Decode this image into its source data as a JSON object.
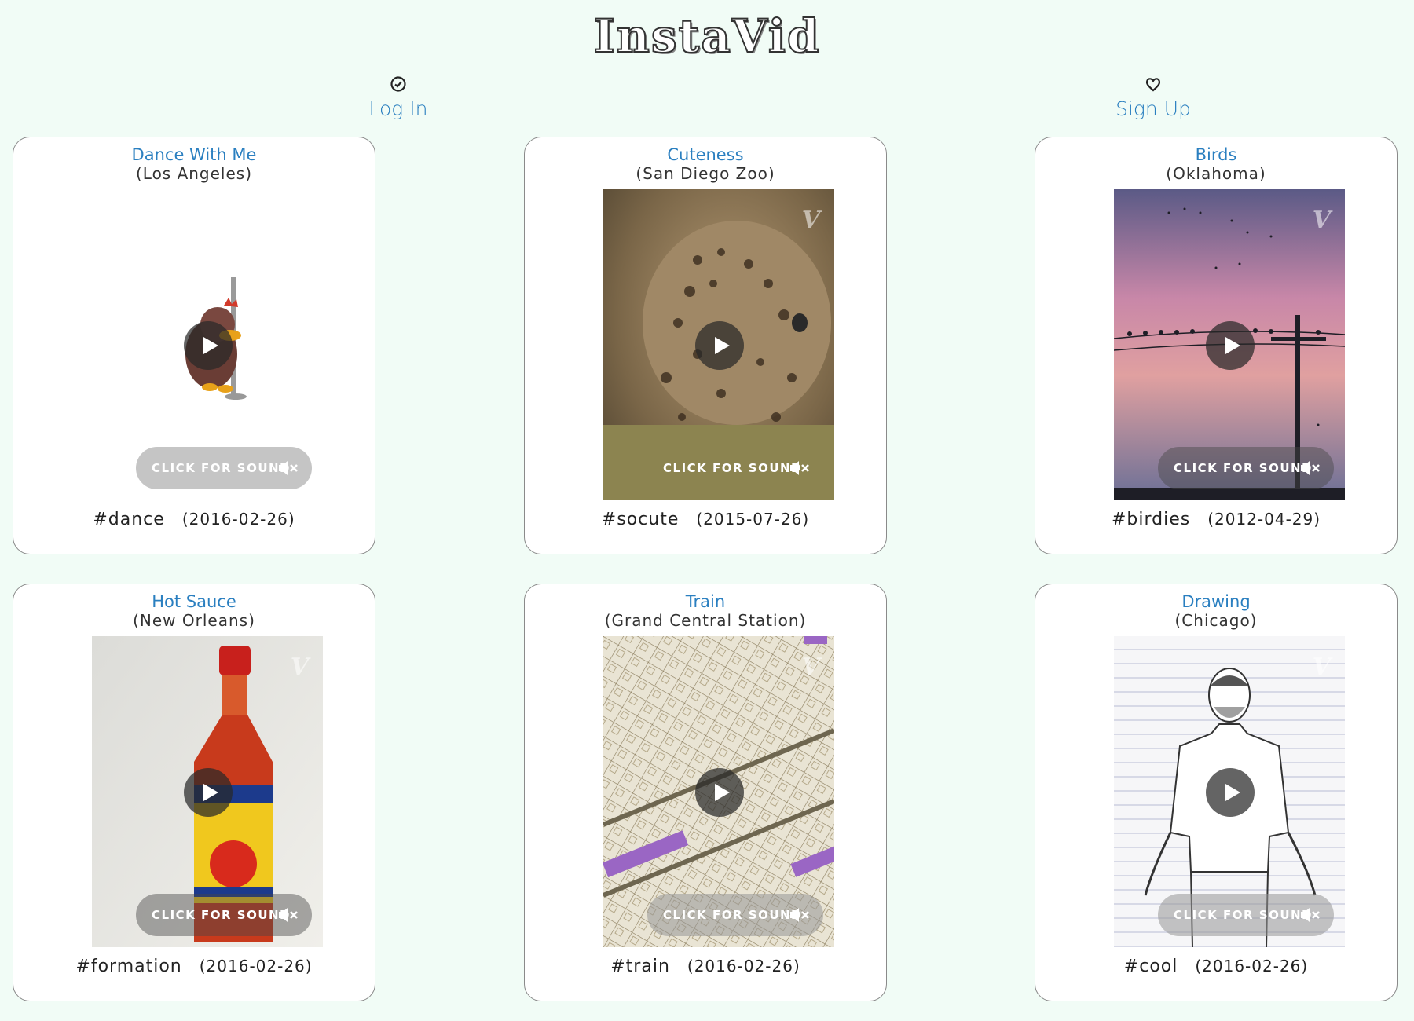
{
  "app": {
    "logo": "InstaVid"
  },
  "nav": {
    "login": {
      "label": "Log In",
      "icon": "check-circle-icon"
    },
    "signup": {
      "label": "Sign Up",
      "icon": "heart-icon"
    }
  },
  "video_controls": {
    "sound_label": "CLICK FOR SOUND",
    "vine_mark": "V"
  },
  "cards": [
    {
      "title": "Dance With Me",
      "location": "(Los Angeles)",
      "tag": "#dance",
      "date": "(2016-02-26)"
    },
    {
      "title": "Cuteness",
      "location": "(San Diego Zoo)",
      "tag": "#socute",
      "date": "(2015-07-26)"
    },
    {
      "title": "Birds",
      "location": "(Oklahoma)",
      "tag": "#birdies",
      "date": "(2012-04-29)"
    },
    {
      "title": "Hot Sauce",
      "location": "(New Orleans)",
      "tag": "#formation",
      "date": "(2016-02-26)"
    },
    {
      "title": "Train",
      "location": "(Grand Central Station)",
      "tag": "#train",
      "date": "(2016-02-26)"
    },
    {
      "title": "Drawing",
      "location": "(Chicago)",
      "tag": "#cool",
      "date": "(2016-02-26)"
    }
  ],
  "colors": {
    "accent": "#2a7fc0",
    "background": "#f1fcf6"
  }
}
